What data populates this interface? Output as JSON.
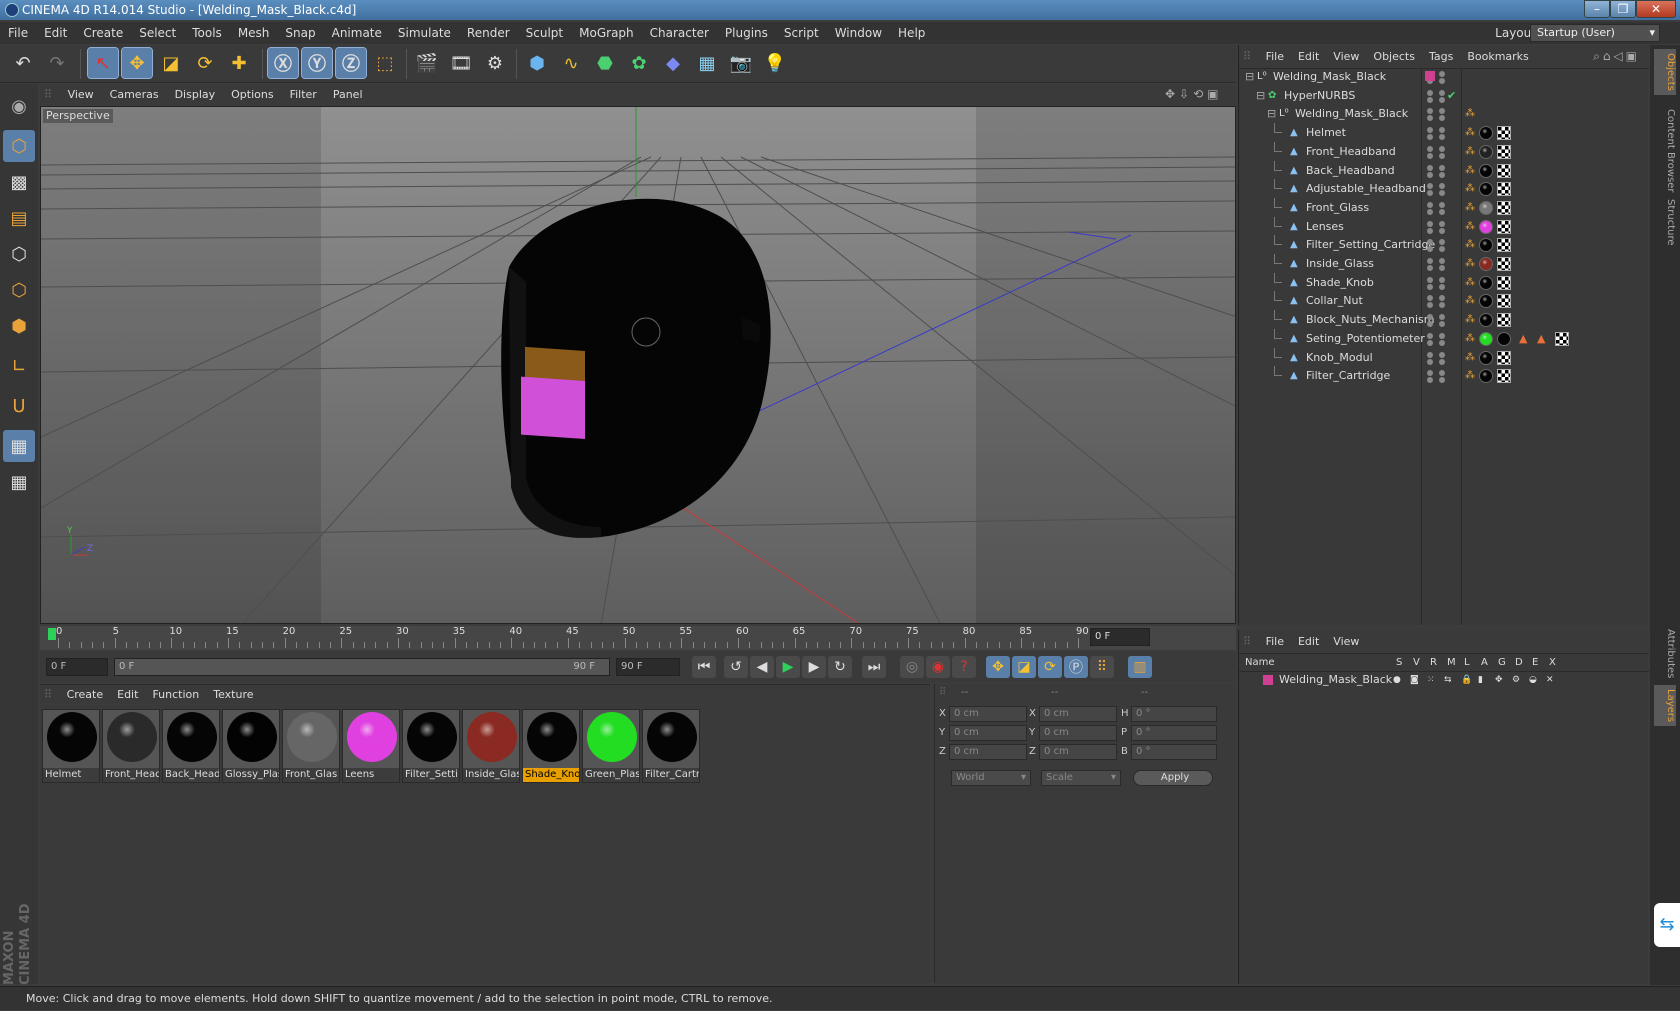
{
  "window": {
    "title": "CINEMA 4D R14.014 Studio - [Welding_Mask_Black.c4d]"
  },
  "menubar": [
    "File",
    "Edit",
    "Create",
    "Select",
    "Tools",
    "Mesh",
    "Snap",
    "Animate",
    "Simulate",
    "Render",
    "Sculpt",
    "MoGraph",
    "Character",
    "Plugins",
    "Script",
    "Window",
    "Help"
  ],
  "layout": {
    "label": "Layout:",
    "value": "Startup (User)"
  },
  "viewport": {
    "menu": [
      "View",
      "Cameras",
      "Display",
      "Options",
      "Filter",
      "Panel"
    ],
    "label": "Perspective",
    "axis_y": "Y",
    "axis_z": "Z"
  },
  "timeline": {
    "ticks": [
      "0",
      "5",
      "10",
      "15",
      "20",
      "25",
      "30",
      "35",
      "40",
      "45",
      "50",
      "55",
      "60",
      "65",
      "70",
      "75",
      "80",
      "85",
      "90"
    ],
    "current_frame": "0 F",
    "start_field": "0 F",
    "range_start": "0 F",
    "range_end": "90 F",
    "end_field": "90 F"
  },
  "materials": {
    "menu": [
      "Create",
      "Edit",
      "Function",
      "Texture"
    ],
    "items": [
      {
        "name": "Helmet",
        "color": "#050505"
      },
      {
        "name": "Front_Head",
        "color": "#2a2a2a"
      },
      {
        "name": "Back_Head",
        "color": "#050505"
      },
      {
        "name": "Glossy_Plas",
        "color": "#030303"
      },
      {
        "name": "Front_Glas",
        "color": "#666666"
      },
      {
        "name": "Leens",
        "color": "#e040e0"
      },
      {
        "name": "Filter_Setti",
        "color": "#050505"
      },
      {
        "name": "Inside_Glas",
        "color": "#8a2a22"
      },
      {
        "name": "Shade_Kno",
        "color": "#050505",
        "selected": true
      },
      {
        "name": "Green_Plas",
        "color": "#22dd22"
      },
      {
        "name": "Filter_Cartr",
        "color": "#050505"
      }
    ]
  },
  "coords": {
    "headers": [
      "--",
      "--",
      "--"
    ],
    "rows": [
      {
        "a": "X",
        "av": "0 cm",
        "b": "X",
        "bv": "0 cm",
        "c": "H",
        "cv": "0 °"
      },
      {
        "a": "Y",
        "av": "0 cm",
        "b": "Y",
        "bv": "0 cm",
        "c": "P",
        "cv": "0 °"
      },
      {
        "a": "Z",
        "av": "0 cm",
        "b": "Z",
        "bv": "0 cm",
        "c": "B",
        "cv": "0 °"
      }
    ],
    "world": "World",
    "scale": "Scale",
    "apply": "Apply"
  },
  "objects": {
    "menu": [
      "File",
      "Edit",
      "View",
      "Objects",
      "Tags",
      "Bookmarks"
    ],
    "tree": [
      {
        "name": "Welding_Mask_Black",
        "level": 0
      },
      {
        "name": "HyperNURBS",
        "level": 1
      },
      {
        "name": "Welding_Mask_Black",
        "level": 2
      },
      {
        "name": "Helmet",
        "level": 3,
        "tag": "#050505"
      },
      {
        "name": "Front_Headband",
        "level": 3,
        "tag": "#222222"
      },
      {
        "name": "Back_Headband",
        "level": 3,
        "tag": "#050505"
      },
      {
        "name": "Adjustable_Headband",
        "level": 3,
        "tag": "#050505"
      },
      {
        "name": "Front_Glass",
        "level": 3,
        "tag": "#777777"
      },
      {
        "name": "Lenses",
        "level": 3,
        "tag": "#e040e0"
      },
      {
        "name": "Filter_Setting_Cartridge",
        "level": 3,
        "tag": "#050505"
      },
      {
        "name": "Inside_Glass",
        "level": 3,
        "tag": "#8a2a22"
      },
      {
        "name": "Shade_Knob",
        "level": 3,
        "tag": "#050505"
      },
      {
        "name": "Collar_Nut",
        "level": 3,
        "tag": "#050505"
      },
      {
        "name": "Block_Nuts_Mechanism",
        "level": 3,
        "tag": "#050505"
      },
      {
        "name": "Seting_Potentiometer",
        "level": 3,
        "tag": "#22dd22"
      },
      {
        "name": "Knob_Modul",
        "level": 3,
        "tag": "#050505"
      },
      {
        "name": "Filter_Cartridge",
        "level": 3,
        "tag": "#050505"
      }
    ]
  },
  "layers": {
    "menu": [
      "File",
      "Edit",
      "View"
    ],
    "columns": [
      "Name",
      "S",
      "V",
      "R",
      "M",
      "L",
      "A",
      "G",
      "D",
      "E",
      "X"
    ],
    "rows": [
      {
        "name": "Welding_Mask_Black",
        "color": "#d04090"
      }
    ]
  },
  "sidetabs": [
    "Objects",
    "Content Browser",
    "Structure",
    "Attributes",
    "Layers"
  ],
  "status": "Move: Click and drag to move elements. Hold down SHIFT to quantize movement / add to the selection in point mode, CTRL to remove.",
  "brand": "MAXON CINEMA 4D"
}
